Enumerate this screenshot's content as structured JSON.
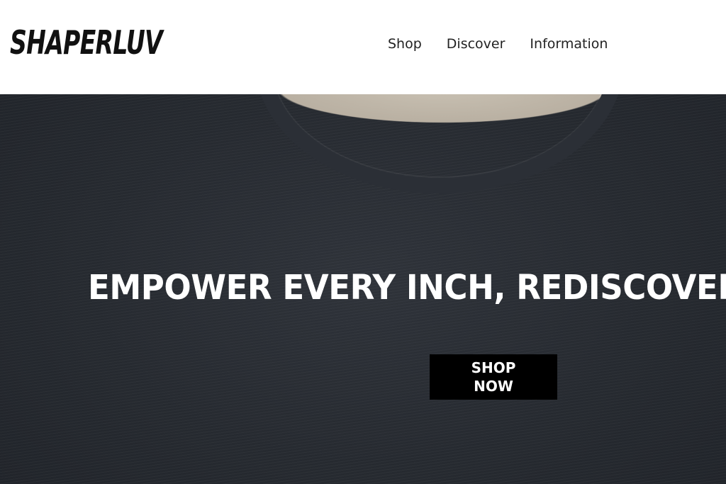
{
  "header": {
    "logo_text": "SHAPERLUV",
    "nav": [
      {
        "label": "Shop"
      },
      {
        "label": "Discover"
      },
      {
        "label": "Information"
      }
    ]
  },
  "hero": {
    "headline": "EMPOWER EVERY INCH, REDISCOVER Y",
    "cta_label": "SHOP NOW",
    "background_image": "dark-tshirt-closeup"
  },
  "colors": {
    "header_bg": "#ffffff",
    "hero_bg": "#262a30",
    "cta_bg": "#000000",
    "text_light": "#ffffff",
    "text_dark": "#222222"
  }
}
